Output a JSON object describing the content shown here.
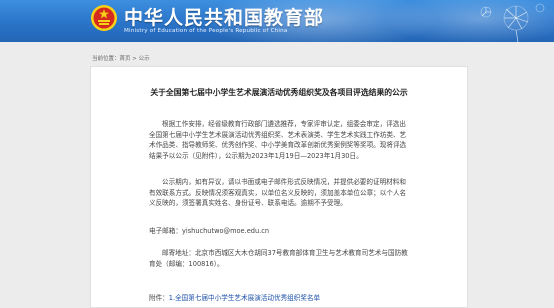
{
  "header": {
    "site_title": "中华人民共和国教育部",
    "site_subtitle": "Ministry of Education of the People's Republic of China",
    "colors": {
      "bar": "#2a74c9",
      "emblem": "#d52b1e",
      "star": "#f7d117"
    },
    "icons": [
      "national-emblem-icon",
      "dandelion-decoration"
    ]
  },
  "breadcrumb": "当前位置：首页 > 公示",
  "article": {
    "title": "关于全国第七届中小学生艺术展演活动优秀组织奖及各项目评选结果的公示",
    "paragraph1": "根据工作安排，经省级教育行政部门遴选推荐，专家评审认定，组委会审定，评选出全国第七届中小学生艺术展演活动优秀组织奖、艺术表演类、学生艺术实践工作坊类、艺术作品类、指导教师奖、优秀创作奖、中小学美育改革创新优秀案例奖等奖项。现将评选结果予以公示（见附件），公示期为2023年1月19日—2023年1月30日。",
    "paragraph2": "公示期内，如有异议，请以书面或电子邮件形式反映情况，并提供必要的证明材料和有效联系方式。反映情况须客观真实，以单位名义反映的，须加盖本单位公章；以个人名义反映的，须签署真实姓名、身份证号、联系电话。逾期不予受理。",
    "email_line": "电子邮箱：yishuchutwo@moe.edu.cn",
    "address_line": "邮寄地址：北京市西城区大木仓胡同37号教育部体育卫生与艺术教育司艺术与国防教育处（邮编：100816）。",
    "attachment_prefix": "附件：",
    "attachment_link": "1.全国第七届中小学生艺术展演活动优秀组织奖名单"
  }
}
